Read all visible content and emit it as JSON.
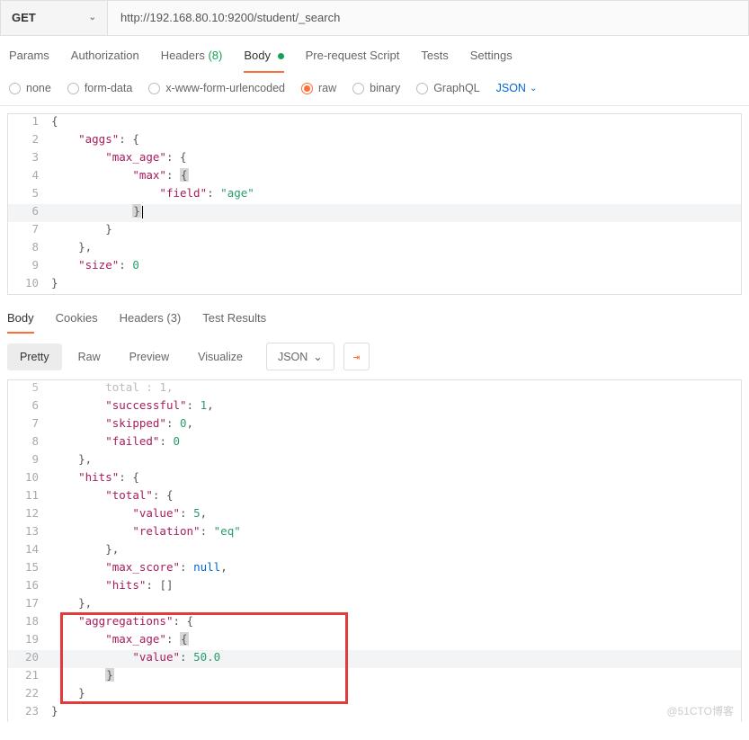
{
  "request": {
    "method": "GET",
    "url": "http://192.168.80.10:9200/student/_search"
  },
  "tabs": {
    "params": "Params",
    "auth": "Authorization",
    "headers": "Headers",
    "headers_count": "(8)",
    "body": "Body",
    "prereq": "Pre-request Script",
    "tests": "Tests",
    "settings": "Settings"
  },
  "body_opts": {
    "none": "none",
    "form": "form-data",
    "xwww": "x-www-form-urlencoded",
    "raw": "raw",
    "binary": "binary",
    "graphql": "GraphQL",
    "format": "JSON"
  },
  "request_body": {
    "l1": "{",
    "l2_k": "\"aggs\"",
    "l2_p": ": {",
    "l3_k": "\"max_age\"",
    "l3_p": ": {",
    "l4_k": "\"max\"",
    "l4_p": ": ",
    "l5_k": "\"field\"",
    "l5_p": ": ",
    "l5_v": "\"age\"",
    "l6": "}",
    "l7": "}",
    "l8": "},",
    "l9_k": "\"size\"",
    "l9_p": ": ",
    "l9_v": "0",
    "l10": "}"
  },
  "resp_tabs": {
    "body": "Body",
    "cookies": "Cookies",
    "headers": "Headers",
    "headers_count": "(3)",
    "test": "Test Results"
  },
  "resp_toolbar": {
    "pretty": "Pretty",
    "raw": "Raw",
    "preview": "Preview",
    "visualize": "Visualize",
    "json": "JSON"
  },
  "resp_body": {
    "r5a": "total",
    "r5b": "1",
    "r6k": "\"successful\"",
    "r6v": "1",
    "r7k": "\"skipped\"",
    "r7v": "0",
    "r8k": "\"failed\"",
    "r8v": "0",
    "r9": "},",
    "r10k": "\"hits\"",
    "r10p": ": {",
    "r11k": "\"total\"",
    "r11p": ": {",
    "r12k": "\"value\"",
    "r12v": "5",
    "r13k": "\"relation\"",
    "r13v": "\"eq\"",
    "r14": "},",
    "r15k": "\"max_score\"",
    "r15v": "null",
    "r16k": "\"hits\"",
    "r16v": "[]",
    "r17": "},",
    "r18k": "\"aggregations\"",
    "r18p": ": {",
    "r19k": "\"max_age\"",
    "r19p": ": ",
    "r20k": "\"value\"",
    "r20v": "50.0",
    "r21": "}",
    "r22": "}",
    "r23": "}"
  },
  "watermark": "@51CTO博客"
}
